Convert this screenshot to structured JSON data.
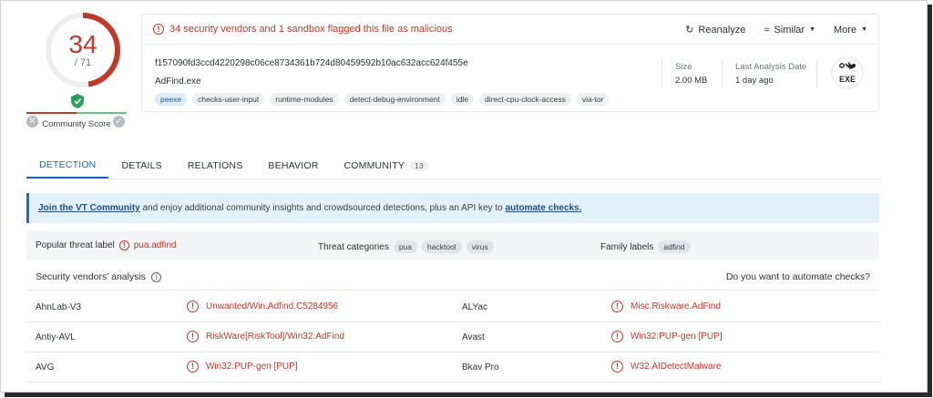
{
  "score": {
    "detections": "34",
    "total": "/ 71",
    "community_label": "Community Score"
  },
  "alert": {
    "text": "34 security vendors and 1 sandbox flagged this file as malicious"
  },
  "actions": {
    "reanalyze": "Reanalyze",
    "similar": "Similar",
    "more": "More"
  },
  "file": {
    "hash": "f157090fd3ccd4220298c06ce8734361b724d80459592b10ac632acc624f455e",
    "name": "AdFind.exe",
    "tags": [
      "peexe",
      "checks-user-input",
      "runtime-modules",
      "detect-debug-environment",
      "idle",
      "direct-cpu-clock-access",
      "via-tor"
    ],
    "size_label": "Size",
    "size_value": "2.00 MB",
    "date_label": "Last Analysis Date",
    "date_value": "1 day ago",
    "type": "EXE"
  },
  "tabs": [
    {
      "label": "DETECTION"
    },
    {
      "label": "DETAILS"
    },
    {
      "label": "RELATIONS"
    },
    {
      "label": "BEHAVIOR"
    },
    {
      "label": "COMMUNITY",
      "badge": "13"
    }
  ],
  "banner": {
    "link1": "Join the VT Community",
    "middle": " and enjoy additional community insights and crowdsourced detections, plus an API key to ",
    "link2": "automate checks."
  },
  "labels": {
    "popular_label": "Popular threat label",
    "popular_value": "pua.adfind",
    "categories_label": "Threat categories",
    "categories": [
      "pua",
      "hacktool",
      "virus"
    ],
    "family_label": "Family labels",
    "family": [
      "adfind"
    ]
  },
  "vendors": {
    "title": "Security vendors' analysis",
    "automate": "Do you want to automate checks?",
    "rows": [
      {
        "v1": "AhnLab-V3",
        "r1": "Unwanted/Win.Adfind.C5284956",
        "v2": "ALYac",
        "r2": "Misc.Riskware.AdFind"
      },
      {
        "v1": "Antiy-AVL",
        "r1": "RiskWare[RiskTool]/Win32.AdFind",
        "v2": "Avast",
        "r2": "Win32:PUP-gen [PUP]"
      },
      {
        "v1": "AVG",
        "r1": "Win32:PUP-gen [PUP]",
        "v2": "Bkav Pro",
        "r2": "W32.AIDetectMalware"
      }
    ]
  },
  "colors": {
    "malicious": "#c0392b",
    "accent": "#1f63b5",
    "banner_bg": "#e3f1fb"
  }
}
